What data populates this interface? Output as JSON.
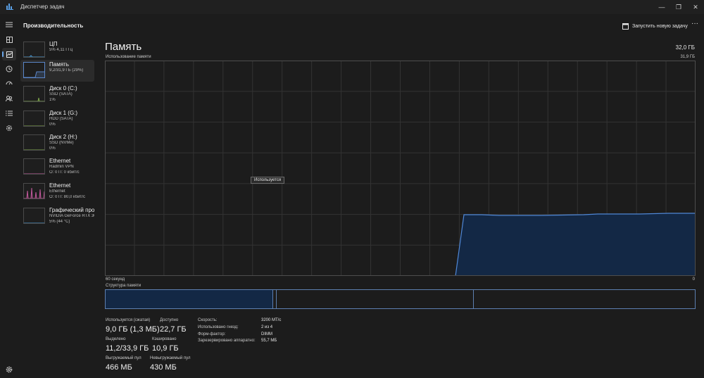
{
  "window": {
    "title": "Диспетчер задач",
    "minimize_glyph": "—",
    "maximize_glyph": "❐",
    "close_glyph": "✕"
  },
  "header": {
    "section_title": "Производительность",
    "run_task_label": "Запустить новую задачу",
    "more_glyph": "···"
  },
  "nav": {
    "items": [
      "menu-icon",
      "processes-icon",
      "performance-icon",
      "app-history-icon",
      "startup-apps-icon",
      "users-icon",
      "details-icon",
      "services-icon"
    ],
    "active": "performance-icon",
    "footer": "settings-icon"
  },
  "devices": [
    {
      "name": "ЦП",
      "line1": "5% 4,11 ГГц",
      "line2": "",
      "color": "#4a9ad4"
    },
    {
      "name": "Память",
      "line1": "9,2/31,9 ГБ (29%)",
      "line2": "",
      "color": "#5b86c9",
      "selected": true
    },
    {
      "name": "Диск 0 (C:)",
      "line1": "SSD (SATA)",
      "line2": "1%",
      "color": "#7ea64a"
    },
    {
      "name": "Диск 1 (G:)",
      "line1": "HDD (SATA)",
      "line2": "0%",
      "color": "#7ea64a"
    },
    {
      "name": "Диск 2 (H:)",
      "line1": "SSD (NVMe)",
      "line2": "0%",
      "color": "#7ea64a"
    },
    {
      "name": "Ethernet",
      "line1": "Radmin VPN",
      "line2": "О: 0 П: 0 кбит/с",
      "color": "#c0589a"
    },
    {
      "name": "Ethernet",
      "line1": "Ethernet",
      "line2": "О: 0 П: 80,0 кбит/с",
      "color": "#c0589a"
    },
    {
      "name": "Графический про",
      "line1": "NVIDIA GeForce RTX 305",
      "line2": "5% (44 °C)",
      "color": "#4a9ad4"
    }
  ],
  "memory": {
    "title": "Память",
    "total": "32,0 ГБ",
    "usage_label": "Использование памяти",
    "usage_max": "31,9 ГБ",
    "axis_left": "60 секунд",
    "axis_right": "0",
    "tooltip": "Используется",
    "structure_label": "Структура памяти",
    "structure": {
      "in_use_fraction": 0.283,
      "modified_fraction": 0.007,
      "standby_fraction": 0.335,
      "free_fraction": 0.375
    },
    "chart_colors": {
      "line": "#4f87d6",
      "fill": "#132845",
      "grid": "#333333",
      "border": "#4d4d4d"
    }
  },
  "stats": {
    "in_use_label": "Используется (сжатая)",
    "in_use_value": "9,0 ГБ (1,3 МБ)",
    "available_label": "Доступно",
    "available_value": "22,7 ГБ",
    "committed_label": "Выделено",
    "committed_value": "11,2/33,9 ГБ",
    "cached_label": "Кэшировано",
    "cached_value": "10,9 ГБ",
    "paged_label": "Выгружаемый пул",
    "paged_value": "466 МБ",
    "nonpaged_label": "Невыгружаемый пул",
    "nonpaged_value": "430 МБ"
  },
  "specs": [
    {
      "label": "Скорость:",
      "value": "3200 MT/c"
    },
    {
      "label": "Использовано гнезд:",
      "value": "2 из 4"
    },
    {
      "label": "Форм-фактор:",
      "value": "DIMM"
    },
    {
      "label": "Зарезервировано аппаратно:",
      "value": "55,7 МБ"
    }
  ]
}
